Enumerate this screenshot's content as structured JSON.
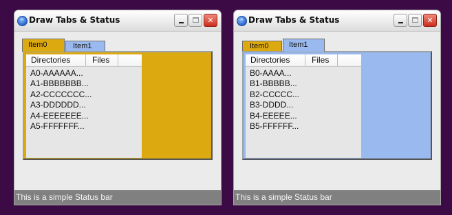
{
  "colors": {
    "desktop": "#3c0a45",
    "item0_gold": "#dcaa10",
    "item1_blue": "#9ab9ee"
  },
  "windows": [
    {
      "title": "Draw Tabs & Status",
      "tabs": [
        {
          "label": "Item0"
        },
        {
          "label": "Item1"
        }
      ],
      "selected_tab": "Item0",
      "columns": [
        "Directories",
        "Files"
      ],
      "rows": [
        "A0-AAAAAA...",
        "A1-BBBBBBB...",
        "A2-CCCCCCC...",
        "A3-DDDDDD...",
        "A4-EEEEEEE...",
        "A5-FFFFFFF..."
      ],
      "status": "This is a simple Status bar"
    },
    {
      "title": "Draw Tabs & Status",
      "tabs": [
        {
          "label": "Item0"
        },
        {
          "label": "Item1"
        }
      ],
      "selected_tab": "Item1",
      "columns": [
        "Directories",
        "Files"
      ],
      "rows": [
        "B0-AAAA...",
        "B1-BBBBB...",
        "B2-CCCCC...",
        "B3-DDDD...",
        "B4-EEEEE...",
        "B5-FFFFFF..."
      ],
      "status": "This is a simple Status bar"
    }
  ]
}
